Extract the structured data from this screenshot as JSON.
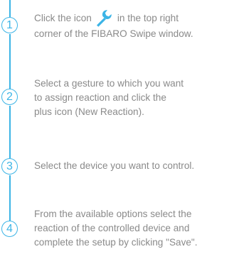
{
  "accent_color": "#3cb4e6",
  "text_color": "#8a8a8a",
  "steps": [
    {
      "number": "1",
      "before_icon": "Click the icon",
      "icon": "wrench-icon",
      "after_icon": "in the top right",
      "line2": "corner of the FIBARO Swipe window."
    },
    {
      "number": "2",
      "line1": "Select a gesture to which you want",
      "line2": "to assign reaction and click the",
      "line3": "plus icon (New Reaction)."
    },
    {
      "number": "3",
      "line1": "Select the device you want to control."
    },
    {
      "number": "4",
      "line1": "From the available options select the",
      "line2": "reaction of the controlled device and",
      "line3": "complete the setup by clicking \"Save\"."
    }
  ]
}
